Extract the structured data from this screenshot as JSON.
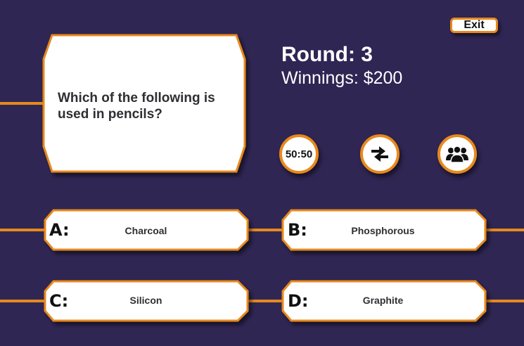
{
  "header": {
    "exit_label": "Exit"
  },
  "question": {
    "text": "Which of the following is used in pencils?"
  },
  "status": {
    "round": "Round: 3",
    "winnings": "Winnings: $200"
  },
  "lifelines": {
    "fifty_fifty_label": "50:50",
    "swap_icon": "swap-arrows-icon",
    "audience_icon": "audience-group-icon"
  },
  "answers": [
    {
      "letter": "A:",
      "text": "Charcoal"
    },
    {
      "letter": "B:",
      "text": "Phosphorous"
    },
    {
      "letter": "C:",
      "text": "Silicon"
    },
    {
      "letter": "D:",
      "text": "Graphite"
    }
  ],
  "colors": {
    "background": "#2f2654",
    "accent": "#e8891c",
    "panel": "#ffffff"
  }
}
